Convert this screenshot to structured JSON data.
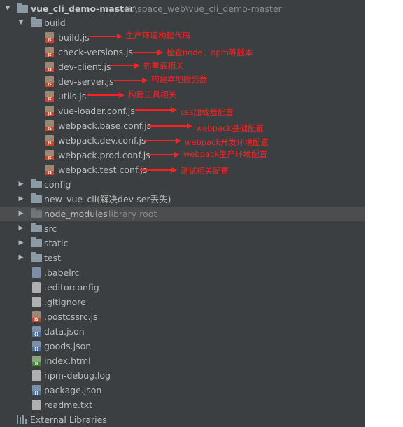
{
  "tree": {
    "root": {
      "name": "vue_cli_demo-master",
      "path": "G:\\space_web\\vue_cli_demo-master"
    },
    "build": {
      "name": "build",
      "files": [
        {
          "name": "build.js",
          "type": "js",
          "annotation": "生产环境构建代码"
        },
        {
          "name": "check-versions.js",
          "type": "js",
          "annotation": "检查node、npm等版本"
        },
        {
          "name": "dev-client.js",
          "type": "js",
          "annotation": "热重载相关"
        },
        {
          "name": "dev-server.js",
          "type": "js",
          "annotation": "构建本地服务器"
        },
        {
          "name": "utils.js",
          "type": "js",
          "annotation": "构建工具相关"
        },
        {
          "name": "vue-loader.conf.js",
          "type": "js",
          "annotation": "css加载器配置"
        },
        {
          "name": "webpack.base.conf.js",
          "type": "js",
          "annotation": "webpack基础配置"
        },
        {
          "name": "webpack.dev.conf.js",
          "type": "js",
          "annotation": "webpack开发环境配置"
        },
        {
          "name": "webpack.prod.conf.js",
          "type": "js",
          "annotation": "webpack生产环境配置"
        },
        {
          "name": "webpack.test.conf.js",
          "type": "js",
          "annotation": "测试相关配置"
        }
      ]
    },
    "folders": [
      {
        "name": "config"
      },
      {
        "name": "new_vue_cli(解决dev-ser丢失)"
      },
      {
        "name": "node_modules",
        "hint": "library root"
      },
      {
        "name": "src"
      },
      {
        "name": "static"
      },
      {
        "name": "test"
      }
    ],
    "files": [
      {
        "name": ".babelrc",
        "type": "config"
      },
      {
        "name": ".editorconfig",
        "type": "txt"
      },
      {
        "name": ".gitignore",
        "type": "txt"
      },
      {
        "name": ".postcssrc.js",
        "type": "js"
      },
      {
        "name": "data.json",
        "type": "json"
      },
      {
        "name": "goods.json",
        "type": "json"
      },
      {
        "name": "index.html",
        "type": "html"
      },
      {
        "name": "npm-debug.log",
        "type": "txt"
      },
      {
        "name": "package.json",
        "type": "json"
      },
      {
        "name": "readme.txt",
        "type": "txt"
      }
    ],
    "external": "External Libraries"
  },
  "icons": {
    "js_tag": "JS",
    "json_tag": "{}",
    "html_tag": "H"
  },
  "colors": {
    "panel_bg": "#3c3f41",
    "text": "#bbbbbb",
    "annotation": "#ff2020",
    "arrow": "#ff2020"
  }
}
